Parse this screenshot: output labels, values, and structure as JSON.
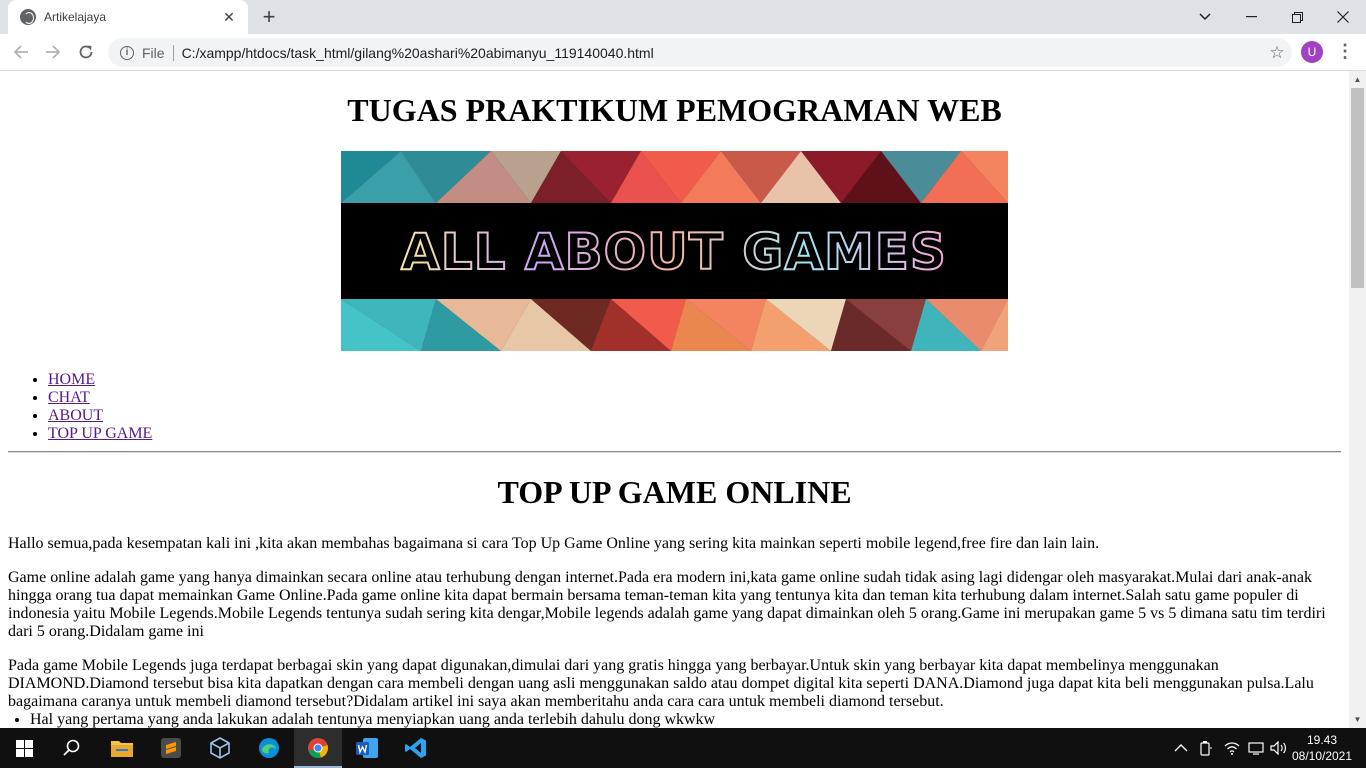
{
  "browser": {
    "tab_title": "Artikelajaya",
    "new_tab": "+",
    "scheme_label": "File",
    "url": "C:/xampp/htdocs/task_html/gilang%20ashari%20abimanyu_119140040.html",
    "profile_initial": "U"
  },
  "page": {
    "title": "TUGAS PRAKTIKUM PEMOGRAMAN WEB",
    "banner_text": "ALL ABOUT GAMES",
    "nav": [
      "HOME",
      "CHAT",
      "ABOUT",
      "TOP UP GAME"
    ],
    "section_title": "TOP UP GAME ONLINE",
    "paragraphs": [
      "Hallo semua,pada kesempatan kali ini ,kita akan membahas bagaimana si cara Top Up Game Online yang sering kita mainkan seperti mobile legend,free fire dan lain lain.",
      "Game online adalah game yang hanya dimainkan secara online atau terhubung dengan internet.Pada era modern ini,kata game online sudah tidak asing lagi didengar oleh masyarakat.Mulai dari anak-anak hingga orang tua dapat memainkan Game Online.Pada game online kita dapat bermain bersama teman-teman kita yang tentunya kita dan teman kita terhubung dalam internet.Salah satu game populer di indonesia yaitu Mobile Legends.Mobile Legends tentunya sudah sering kita dengar,Mobile legends adalah game yang dapat dimainkan oleh 5 orang.Game ini merupakan game 5 vs 5 dimana satu tim terdiri dari 5 orang.Didalam game ini",
      "Pada game Mobile Legends juga terdapat berbagai skin yang dapat digunakan,dimulai dari yang gratis hingga yang berbayar.Untuk skin yang berbayar kita dapat membelinya menggunakan DIAMOND.Diamond tersebut bisa kita dapatkan dengan cara membeli dengan uang asli menggunakan saldo atau dompet digital kita seperti DANA.Diamond juga dapat kita beli menggunakan pulsa.Lalu bagaimana caranya untuk membeli diamond tersebut?Didalam artikel ini saya akan memberitahu anda cara cara untuk membeli diamond tersebut."
    ],
    "steps": [
      "Hal yang pertama yang anda lakukan adalah tentunya menyiapkan uang anda terlebih dahulu dong wkwkw"
    ]
  },
  "taskbar": {
    "time": "19.43",
    "date": "08/10/2021"
  },
  "colors": {
    "link": "#551a8b",
    "tabbar": "#dee1e6",
    "taskbar": "#101010",
    "avatar": "#a142c2"
  }
}
